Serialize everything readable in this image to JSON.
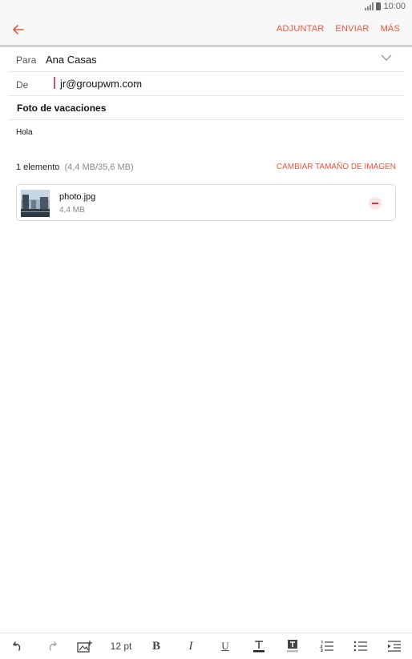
{
  "status_bar": {
    "time": "10:00"
  },
  "header": {
    "actions": {
      "attach": "ADJUNTAR",
      "send": "ENVIAR",
      "more": "MÁS"
    }
  },
  "fields": {
    "to_label": "Para",
    "to_value": "Ana Casas",
    "from_label": "De",
    "from_value": "jr@groupwm.com",
    "subject": "Foto de vacaciones"
  },
  "body": {
    "text": "Hola"
  },
  "attachments": {
    "count_label": "1 elemento",
    "size_label": "(4,4 MB/35,6 MB)",
    "resize_label": "CAMBIAR TAMAÑO DE IMAGEN",
    "items": [
      {
        "name": "photo.jpg",
        "size": "4,4 MB"
      }
    ]
  },
  "toolbar": {
    "font_size": "12 pt",
    "bold": "B",
    "italic": "I",
    "underline": "U"
  },
  "colors": {
    "accent": "#e2583e",
    "from_caret": "#c4508a",
    "remove": "#d9364a"
  }
}
